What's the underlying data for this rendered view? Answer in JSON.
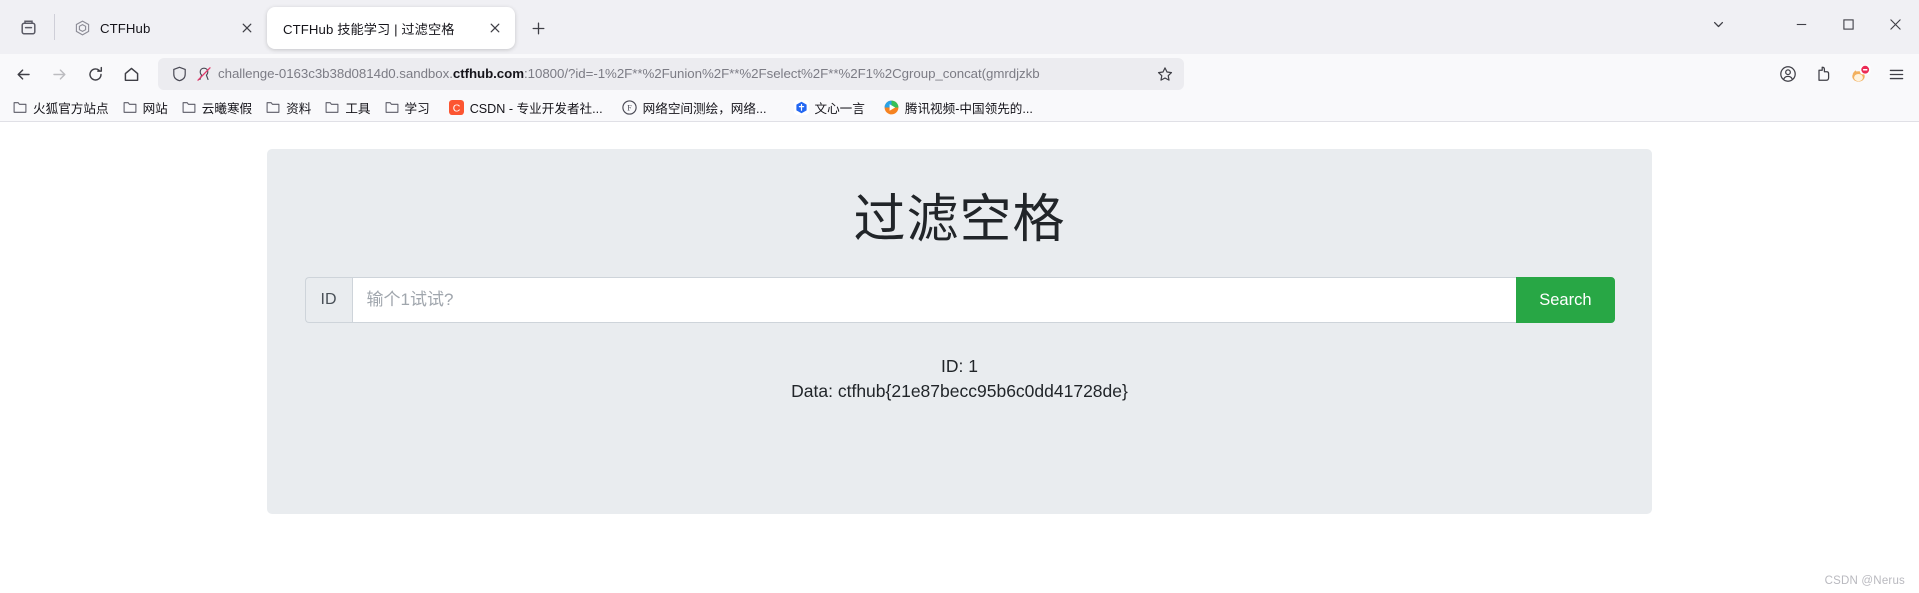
{
  "window": {
    "controls": {
      "list_all_tabs": "chevron-down",
      "minimize": "minimize",
      "maximize": "maximize",
      "close": "close"
    }
  },
  "tabs": [
    {
      "title": "CTFHub",
      "favicon": "ctfhub-logo-icon",
      "active": false,
      "close_label": "×"
    },
    {
      "title": "CTFHub 技能学习 | 过滤空格",
      "favicon": "none",
      "active": true,
      "close_label": "×"
    }
  ],
  "newtab_label": "+",
  "toolbar": {
    "back_label": "back-arrow",
    "forward_label": "forward-arrow",
    "reload_label": "reload",
    "home_label": "home",
    "account_label": "account",
    "extensions_label": "extensions",
    "profile_label": "profile-avatar",
    "menu_label": "hamburger-menu"
  },
  "address_bar": {
    "shield_icon": "shield-icon",
    "tracking_icon": "tracking-protection-off-icon",
    "url_prefix": "challenge-0163c3b38d0814d0.sandbox.",
    "url_host": "ctfhub.com",
    "url_suffix": ":10800/?id=-1%2F**%2Funion%2F**%2Fselect%2F**%2F1%2Cgroup_concat(gmrdjzkb",
    "bookmark_star": "star-icon"
  },
  "bookmarks": [
    {
      "label": "火狐官方站点",
      "icon": "folder-icon"
    },
    {
      "label": "网站",
      "icon": "folder-icon"
    },
    {
      "label": "云曦寒假",
      "icon": "folder-icon"
    },
    {
      "label": "资料",
      "icon": "folder-icon"
    },
    {
      "label": "工具",
      "icon": "folder-icon"
    },
    {
      "label": "学习",
      "icon": "folder-icon"
    },
    {
      "label": "CSDN - 专业开发者社...",
      "icon": "csdn-icon"
    },
    {
      "label": "网络空间测绘，网络...",
      "icon": "fofa-icon"
    },
    {
      "label": "文心一言",
      "icon": "yiyan-icon"
    },
    {
      "label": "腾讯视频-中国领先的...",
      "icon": "tencent-video-icon"
    }
  ],
  "page": {
    "heading": "过滤空格",
    "input_addon_label": "ID",
    "input_value": "",
    "input_placeholder": "输个1试试?",
    "search_button_label": "Search",
    "result_id_line": "ID: 1",
    "result_data_line": "Data: ctfhub{21e87becc95b6c0dd41728de}",
    "accent_color": "#28a745",
    "panel_color": "#e9ecef"
  },
  "watermark": "CSDN @Nerus"
}
